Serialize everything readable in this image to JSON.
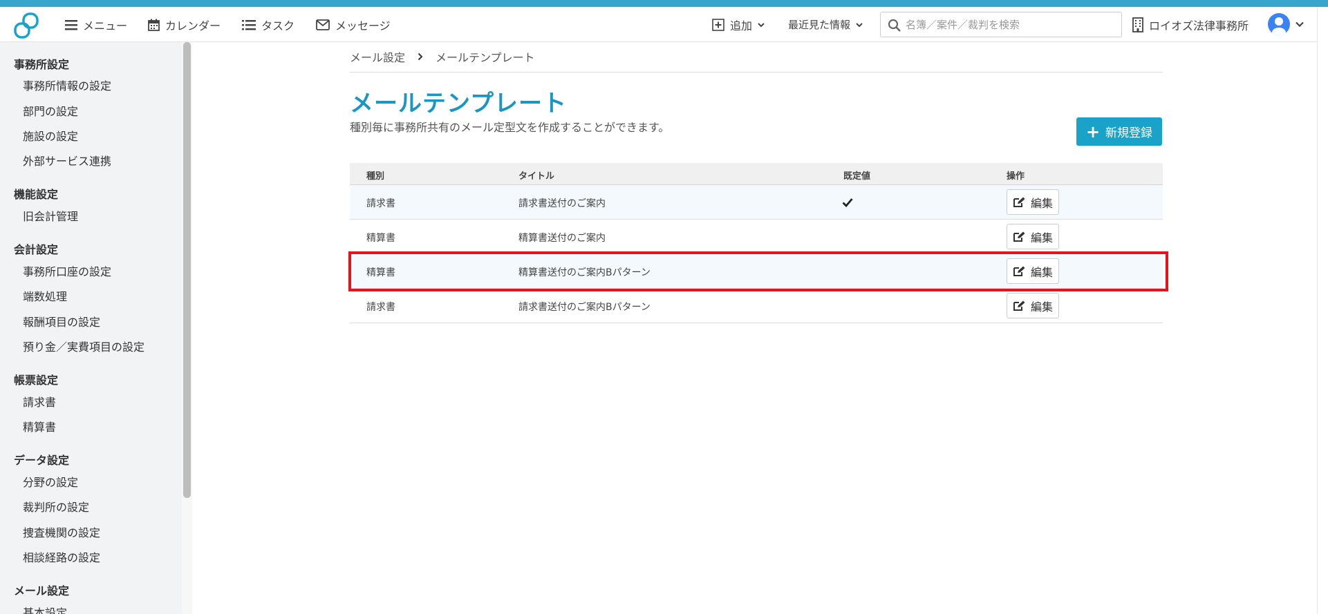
{
  "navbar": {
    "menu_label": "メニュー",
    "calendar_label": "カレンダー",
    "task_label": "タスク",
    "message_label": "メッセージ",
    "add_label": "追加",
    "recent_label": "最近見た情報",
    "search_placeholder": "名簿／案件／裁判を検索",
    "office_name": "ロイオズ法律事務所"
  },
  "sidebar": {
    "sections": [
      {
        "heading": "事務所設定",
        "items": [
          "事務所情報の設定",
          "部門の設定",
          "施設の設定",
          "外部サービス連携"
        ]
      },
      {
        "heading": "機能設定",
        "items": [
          "旧会計管理"
        ]
      },
      {
        "heading": "会計設定",
        "items": [
          "事務所口座の設定",
          "端数処理",
          "報酬項目の設定",
          "預り金／実費項目の設定"
        ]
      },
      {
        "heading": "帳票設定",
        "items": [
          "請求書",
          "精算書"
        ]
      },
      {
        "heading": "データ設定",
        "items": [
          "分野の設定",
          "裁判所の設定",
          "捜査機関の設定",
          "相談経路の設定"
        ]
      },
      {
        "heading": "メール設定",
        "items": [
          "基本設定"
        ]
      }
    ]
  },
  "breadcrumb": {
    "parent": "メール設定",
    "current": "メールテンプレート"
  },
  "page": {
    "title": "メールテンプレート",
    "description": "種別毎に事務所共有のメール定型文を作成することができます。",
    "new_button_label": "新規登録"
  },
  "table": {
    "headers": {
      "type": "種別",
      "title": "タイトル",
      "default": "既定値",
      "operation": "操作"
    },
    "rows": [
      {
        "type": "請求書",
        "title": "請求書送付のご案内",
        "is_default": true,
        "edit_label": "編集"
      },
      {
        "type": "精算書",
        "title": "精算書送付のご案内",
        "is_default": false,
        "edit_label": "編集"
      },
      {
        "type": "精算書",
        "title": "精算書送付のご案内Bパターン",
        "is_default": false,
        "edit_label": "編集"
      },
      {
        "type": "請求書",
        "title": "請求書送付のご案内Bパターン",
        "is_default": false,
        "edit_label": "編集"
      }
    ]
  },
  "colors": {
    "accent": "#19a3c8",
    "title": "#1a96c4",
    "highlight": "#e4141f",
    "topbar": "#3aa5cc"
  }
}
